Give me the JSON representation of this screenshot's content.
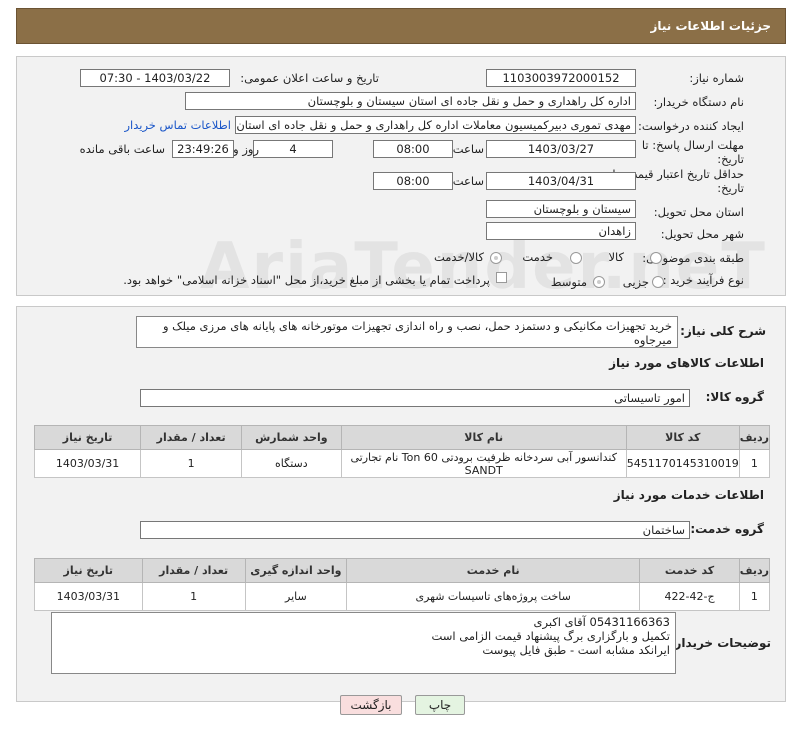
{
  "header": {
    "title": "جزئیات اطلاعات نیاز"
  },
  "fields": {
    "need_number_label": "شماره نیاز:",
    "need_number": "1103003972000152",
    "announce_label": "تاریخ و ساعت اعلان عمومی:",
    "announce_value": "1403/03/22 - 07:30",
    "buyer_org_label": "نام دستگاه خریدار:",
    "buyer_org": "اداره کل راهداری و حمل و نقل جاده ای استان سیستان و بلوچستان",
    "creator_label": "ایجاد کننده درخواست:",
    "creator": "مهدی تموری دبیرکمیسیون معاملات اداره کل راهداری و حمل و نقل جاده ای استان",
    "contact_link": "اطلاعات تماس خریدار",
    "deadline_label_1": "مهلت ارسال پاسخ: تا",
    "deadline_label_2": "تاریخ:",
    "deadline_date": "1403/03/27",
    "time_label": "ساعت",
    "deadline_time": "08:00",
    "days_value": "4",
    "days_label": "روز و",
    "remaining_time": "23:49:26",
    "remaining_label": "ساعت باقی مانده",
    "validity_label_1": "حداقل تاریخ اعتبار قیمت: تا",
    "validity_label_2": "تاریخ:",
    "validity_date": "1403/04/31",
    "validity_time": "08:00",
    "province_label": "استان محل تحویل:",
    "province": "سیستان و بلوچستان",
    "city_label": "شهر محل تحویل:",
    "city": "زاهدان",
    "category_label": "طبقه بندی موضوعی:",
    "category_options": [
      "کالا",
      "خدمت",
      "کالا/خدمت"
    ],
    "purchase_type_label": "نوع فرآیند خرید :",
    "purchase_options": [
      "جزیی",
      "متوسط"
    ],
    "payment_note": "پرداخت تمام یا بخشی از مبلغ خرید،از محل \"اسناد خزانه اسلامی\" خواهد بود."
  },
  "description": {
    "label": "شرح کلی نیاز:",
    "text": "خرید تجهیزات مکانیکی و دستمزد حمل، نصب و راه اندازی تجهیزات موتورخانه های پایانه های مرزی میلک و میرجاوه"
  },
  "goods": {
    "section_title": "اطلاعات کالاهای مورد نیاز",
    "group_label": "گروه کالا:",
    "group_value": "امور تاسیساتی",
    "headers": [
      "ردیف",
      "کد کالا",
      "نام کالا",
      "واحد شمارش",
      "تعداد / مقدار",
      "تاریخ نیاز"
    ],
    "rows": [
      [
        "1",
        "5451170145310019",
        "کندانسور آبی سردخانه ظرفیت برودتی 60 Ton نام تجارتی SANDT",
        "دستگاه",
        "1",
        "1403/03/31"
      ]
    ]
  },
  "services": {
    "section_title": "اطلاعات خدمات مورد نیاز",
    "group_label": "گروه خدمت:",
    "group_value": "ساختمان",
    "headers": [
      "ردیف",
      "کد خدمت",
      "نام خدمت",
      "واحد اندازه گیری",
      "تعداد / مقدار",
      "تاریخ نیاز"
    ],
    "rows": [
      [
        "1",
        "ج-42-422",
        "ساخت پروژه‌های تاسیسات شهری",
        "سایر",
        "1",
        "1403/03/31"
      ]
    ]
  },
  "notes": {
    "label": "توضیحات خریدار:",
    "lines": [
      "05431166363 آقای اکبری",
      "تکمیل و بارگزاری برگ پیشنهاد قیمت الزامی است",
      "ایرانکد مشابه است - طبق فایل پیوست"
    ]
  },
  "buttons": {
    "print": "چاپ",
    "back": "بازگشت"
  },
  "watermark": "AriaTender.neT",
  "colors": {
    "titlebar": "#8b6f47",
    "link": "#1a56c8",
    "back_button": "#f9dede",
    "print_button": "#e4f4e1"
  }
}
